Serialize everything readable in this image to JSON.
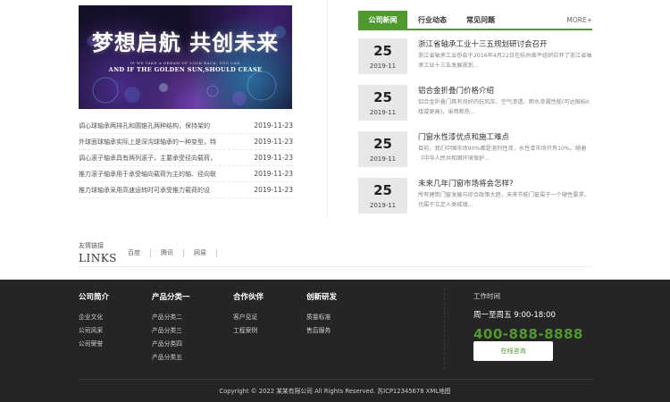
{
  "banner": {
    "title": "梦想启航 共创未来",
    "small_text": "IF WE TAKE A DREAM OF LOOK BACK, YOU CAN",
    "subtitle": "AND IF THE GOLDEN SUN,SHOULD CEASE"
  },
  "news_list": [
    {
      "title": "调心球轴承两排孔和圆锥孔两种结构，保持架的",
      "date": "2019-11-23"
    },
    {
      "title": "外球面球轴承实际上是深沟球轴承的一种变型，特",
      "date": "2019-11-23"
    },
    {
      "title": "调心滚子轴承具有两列滚子，主要承受径向载荷，",
      "date": "2019-11-23"
    },
    {
      "title": "推力滚子轴承用于承受轴向载荷为主的轴、径向联",
      "date": "2019-11-23"
    },
    {
      "title": "推力球轴承采用高速运转时可承受推力载荷的设",
      "date": "2019-11-23"
    }
  ],
  "tabs": {
    "items": [
      "公司新闻",
      "行业动态",
      "常见问题"
    ],
    "more": "MORE+"
  },
  "feed": [
    {
      "day": "25",
      "ym": "2019-11",
      "title": "浙江省轴承工业十三五规划研讨会召开",
      "desc": "浙江省轴承工业协会于2016年4月22日在杭州临平组织召开了浙江省轴承工业十三五发展规划..."
    },
    {
      "day": "25",
      "ym": "2019-11",
      "title": "铝合金折叠门价格介绍",
      "desc": "铝合金折叠门具有良好的抗风压、空气渗透、雨水渗漏性能(可达国标II级或更高)，采用断热..."
    },
    {
      "day": "25",
      "ym": "2019-11",
      "title": "门窗水性漆优点和施工难点",
      "desc": "目前，我们中国市场90%都是溶剂性漆，水性漆市场只有10%。随着《中华人民共和国环境保护..."
    },
    {
      "day": "25",
      "ym": "2019-11",
      "title": "未来几年门窗市场将会怎样?",
      "desc": "所有建筑门窗发展与综合政策大趋，未来节能门窗属于一个硬性要求，也属于立足人类城镇..."
    }
  ],
  "links": {
    "label_cn": "友情链接",
    "label_en": "LINKS",
    "items": [
      "百度",
      "腾讯",
      "网易"
    ]
  },
  "footer": {
    "columns": [
      {
        "title": "公司简介",
        "items": [
          "企业文化",
          "公司风采",
          "公司荣誉"
        ]
      },
      {
        "title": "产品分类一",
        "items": [
          "产品分类二",
          "产品分类三",
          "产品分类四",
          "产品分类五"
        ]
      },
      {
        "title": "合作伙伴",
        "items": [
          "客户见证",
          "工程案例"
        ]
      },
      {
        "title": "创新研发",
        "items": [
          "质量标准",
          "售后服务"
        ]
      }
    ],
    "hours_label": "工作时间",
    "hours_time": "周一至周五 9:00-18:00",
    "phone": "400-888-8888",
    "consult": "在线咨询",
    "copyright": "Copyright © 2022 某某有限公司 All Rights Reserved. 苏ICP12345678 XML地图"
  },
  "colors": {
    "accent": "#4f9a2e",
    "footer_bg": "#252525"
  }
}
